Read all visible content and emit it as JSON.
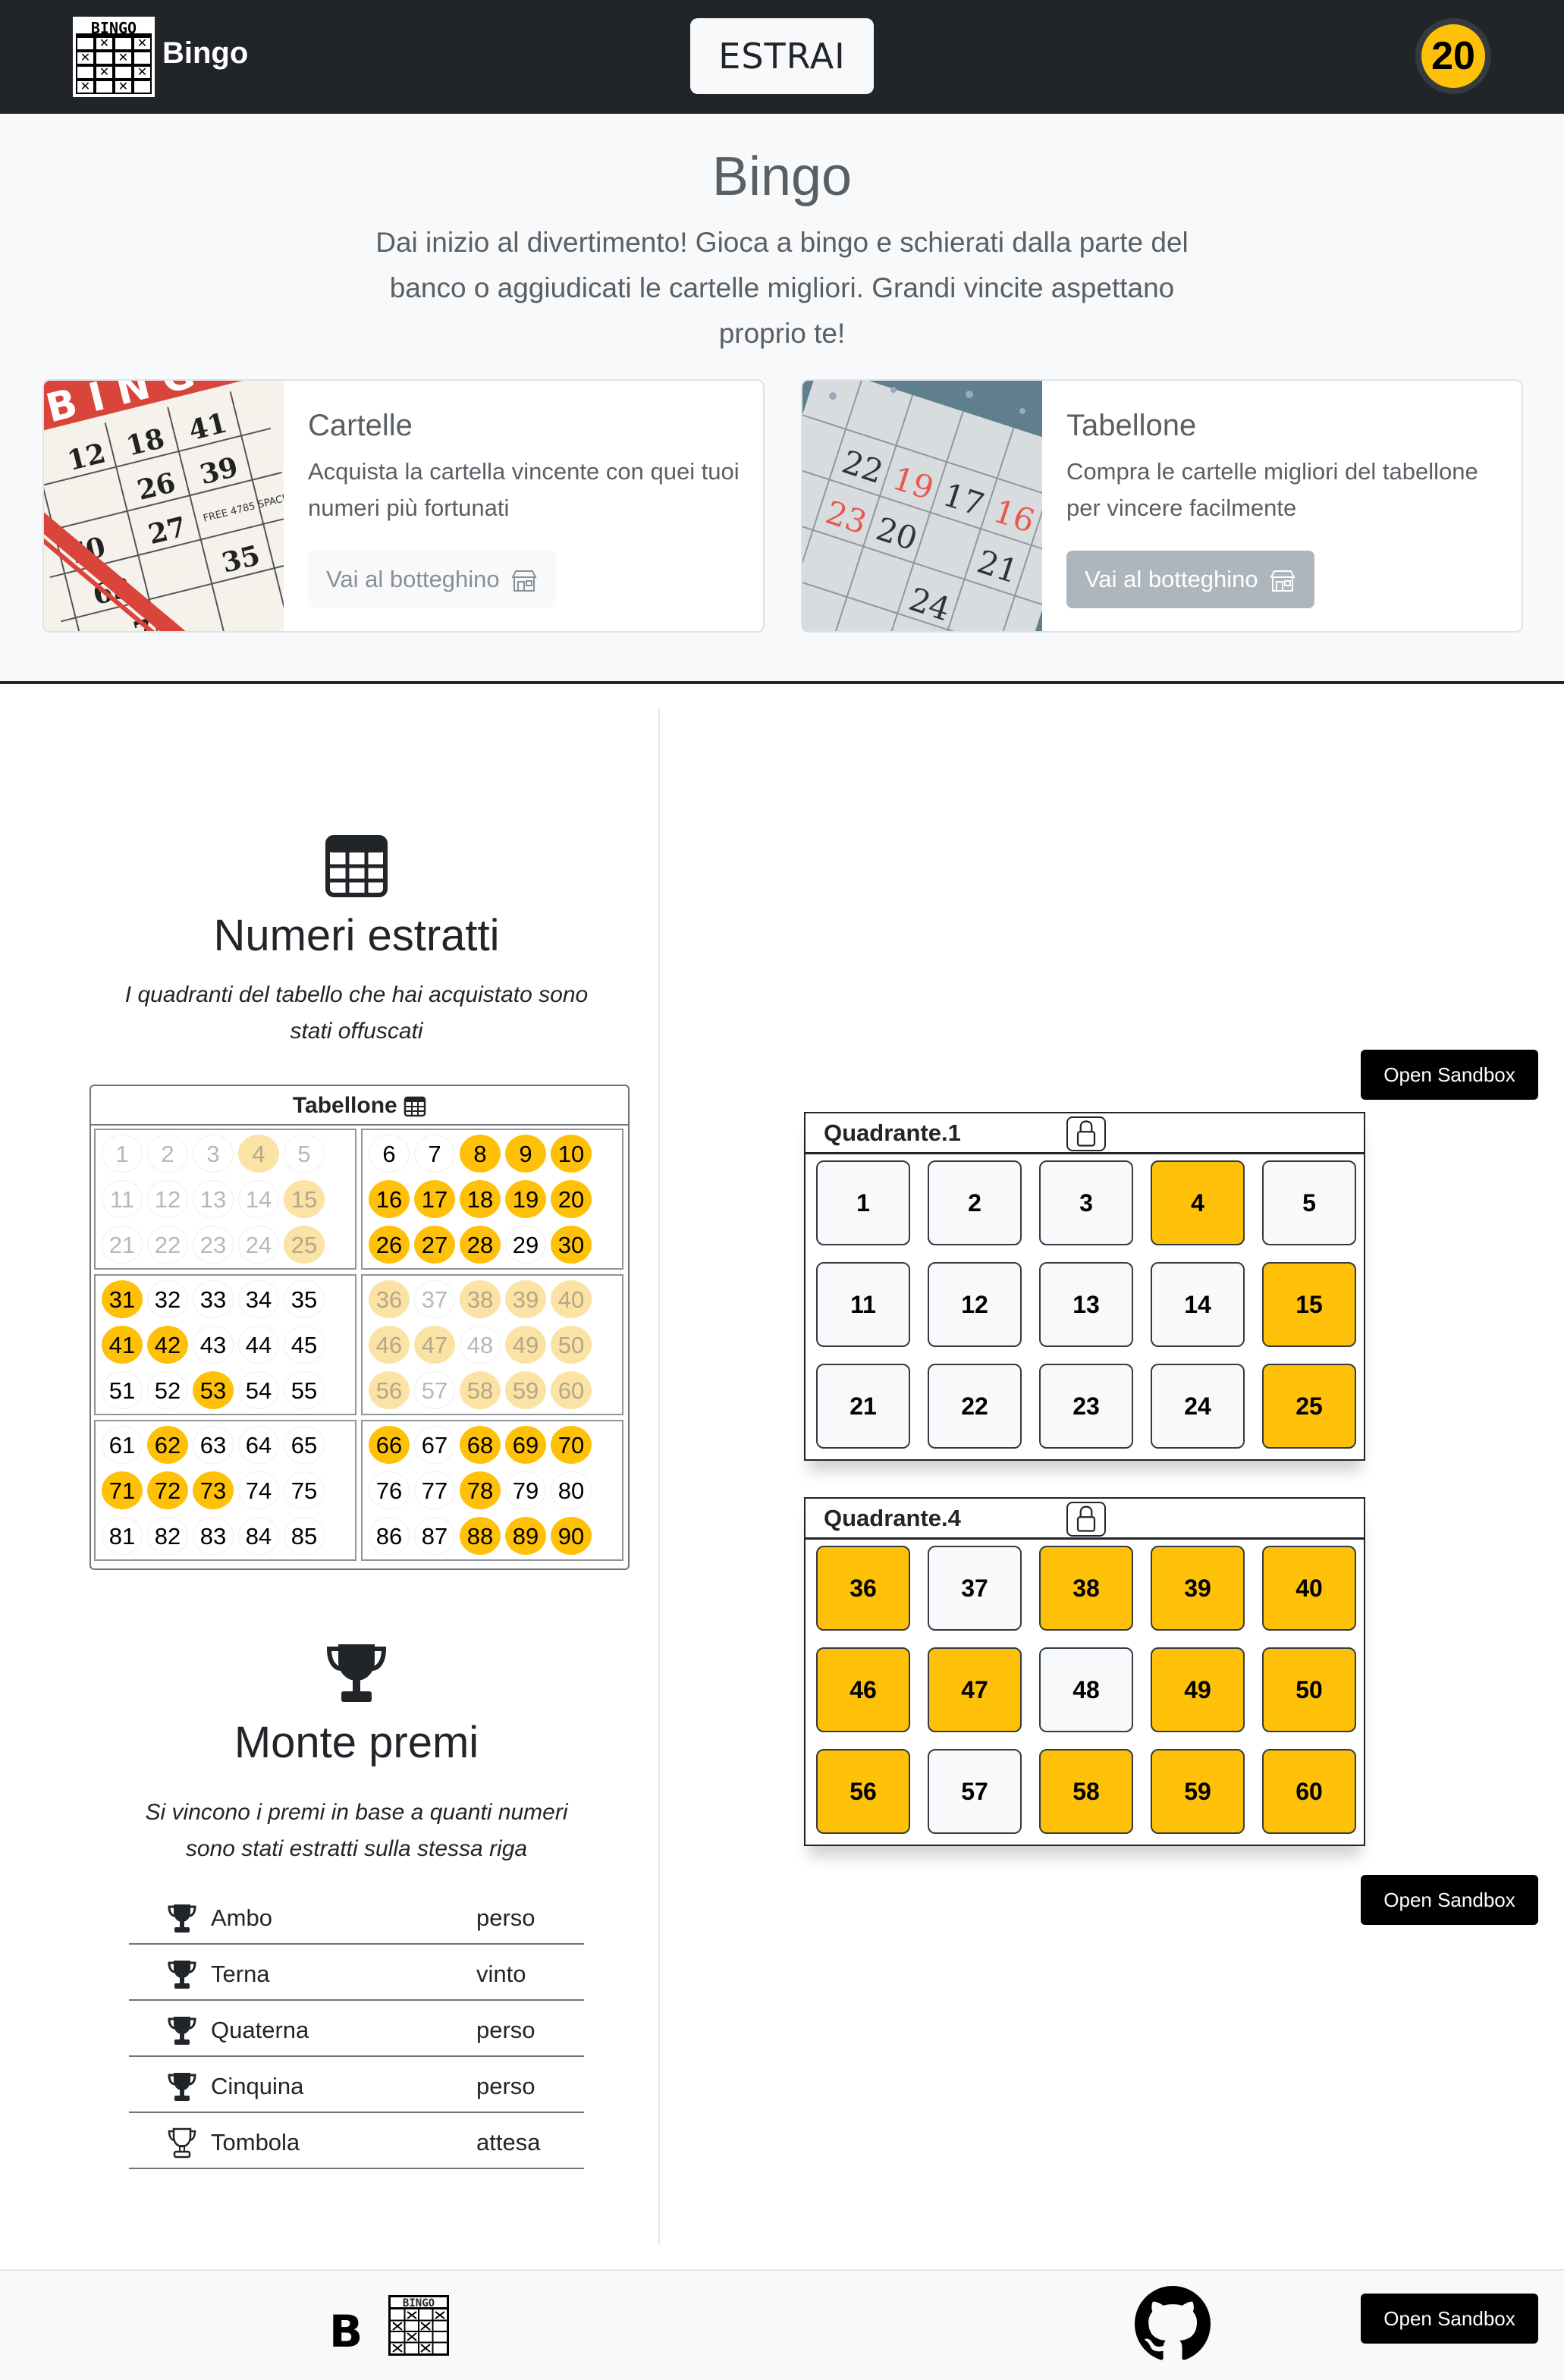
{
  "navbar": {
    "logo_text": "BINGO",
    "brand": "Bingo",
    "draw_button": "ESTRAI",
    "counter": "20"
  },
  "hero": {
    "title": "Bingo",
    "lead": "Dai inizio al divertimento! Gioca a bingo e schierati dalla parte del banco o aggiudicati le cartelle migliori. Grandi vincite aspettano proprio te!",
    "cards": [
      {
        "title": "Cartelle",
        "text": "Acquista la cartella vincente con quei tuoi numeri più fortunati",
        "button": "Vai al botteghino"
      },
      {
        "title": "Tabellone",
        "text": "Compra le cartelle migliori del tabellone per vincere facilmente",
        "button": "Vai al botteghino"
      }
    ]
  },
  "numeri": {
    "title": "Numeri estratti",
    "subtitle": "I quadranti del tabello che hai acquistato sono stati offuscati",
    "tabellone_label": "Tabellone",
    "highlight_color": "#ffc107",
    "quadrants": [
      {
        "faded": true,
        "numbers": [
          1,
          2,
          3,
          4,
          5,
          11,
          12,
          13,
          14,
          15,
          21,
          22,
          23,
          24,
          25
        ],
        "drawn": [
          4,
          15,
          25
        ]
      },
      {
        "faded": false,
        "numbers": [
          6,
          7,
          8,
          9,
          10,
          16,
          17,
          18,
          19,
          20,
          26,
          27,
          28,
          29,
          30
        ],
        "drawn": [
          8,
          9,
          10,
          16,
          17,
          18,
          19,
          20,
          26,
          27,
          28,
          30
        ]
      },
      {
        "faded": false,
        "numbers": [
          31,
          32,
          33,
          34,
          35,
          41,
          42,
          43,
          44,
          45,
          51,
          52,
          53,
          54,
          55
        ],
        "drawn": [
          31,
          41,
          42,
          53
        ]
      },
      {
        "faded": true,
        "numbers": [
          36,
          37,
          38,
          39,
          40,
          46,
          47,
          48,
          49,
          50,
          56,
          57,
          58,
          59,
          60
        ],
        "drawn": [
          36,
          38,
          39,
          40,
          46,
          47,
          49,
          50,
          56,
          58,
          59,
          60
        ]
      },
      {
        "faded": false,
        "numbers": [
          61,
          62,
          63,
          64,
          65,
          71,
          72,
          73,
          74,
          75,
          81,
          82,
          83,
          84,
          85
        ],
        "drawn": [
          62,
          71,
          72,
          73
        ]
      },
      {
        "faded": false,
        "numbers": [
          66,
          67,
          68,
          69,
          70,
          76,
          77,
          78,
          79,
          80,
          86,
          87,
          88,
          89,
          90
        ],
        "drawn": [
          66,
          68,
          69,
          70,
          78,
          88,
          89,
          90
        ]
      }
    ]
  },
  "premi": {
    "title": "Monte premi",
    "subtitle": "Si vincono i premi in base a quanti numeri sono stati estratti sulla stessa riga",
    "rows": [
      {
        "name": "Ambo",
        "status": "perso",
        "icon": "trophy-filled-icon"
      },
      {
        "name": "Terna",
        "status": "vinto",
        "icon": "trophy-filled-icon"
      },
      {
        "name": "Quaterna",
        "status": "perso",
        "icon": "trophy-filled-icon"
      },
      {
        "name": "Cinquina",
        "status": "perso",
        "icon": "trophy-filled-icon"
      },
      {
        "name": "Tombola",
        "status": "attesa",
        "icon": "trophy-outline-icon"
      }
    ]
  },
  "quadranti": [
    {
      "title": "Quadrante.1",
      "numbers": [
        1,
        2,
        3,
        4,
        5,
        11,
        12,
        13,
        14,
        15,
        21,
        22,
        23,
        24,
        25
      ],
      "drawn": [
        4,
        15,
        25
      ]
    },
    {
      "title": "Quadrante.4",
      "numbers": [
        36,
        37,
        38,
        39,
        40,
        46,
        47,
        48,
        49,
        50,
        56,
        57,
        58,
        59,
        60
      ],
      "drawn": [
        36,
        38,
        39,
        40,
        46,
        47,
        49,
        50,
        56,
        58,
        59,
        60
      ]
    }
  ],
  "sandbox": {
    "label": "Open Sandbox"
  },
  "footer": {
    "letter": "B",
    "logo_text": "BINGO"
  }
}
